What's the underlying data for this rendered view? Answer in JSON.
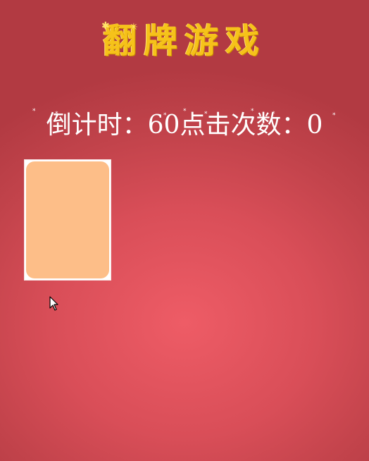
{
  "title": "翻牌游戏",
  "status": {
    "countdown_label": "倒计时：",
    "countdown_value": "60",
    "clicks_label": "点击次数：",
    "clicks_value": "0"
  },
  "cards": [
    {
      "state": "face-down",
      "color": "#fdbe88"
    }
  ],
  "colors": {
    "background": "#e0525c",
    "title": "#f6c21a",
    "text": "#ffffff",
    "card_back": "#fdbe88"
  }
}
